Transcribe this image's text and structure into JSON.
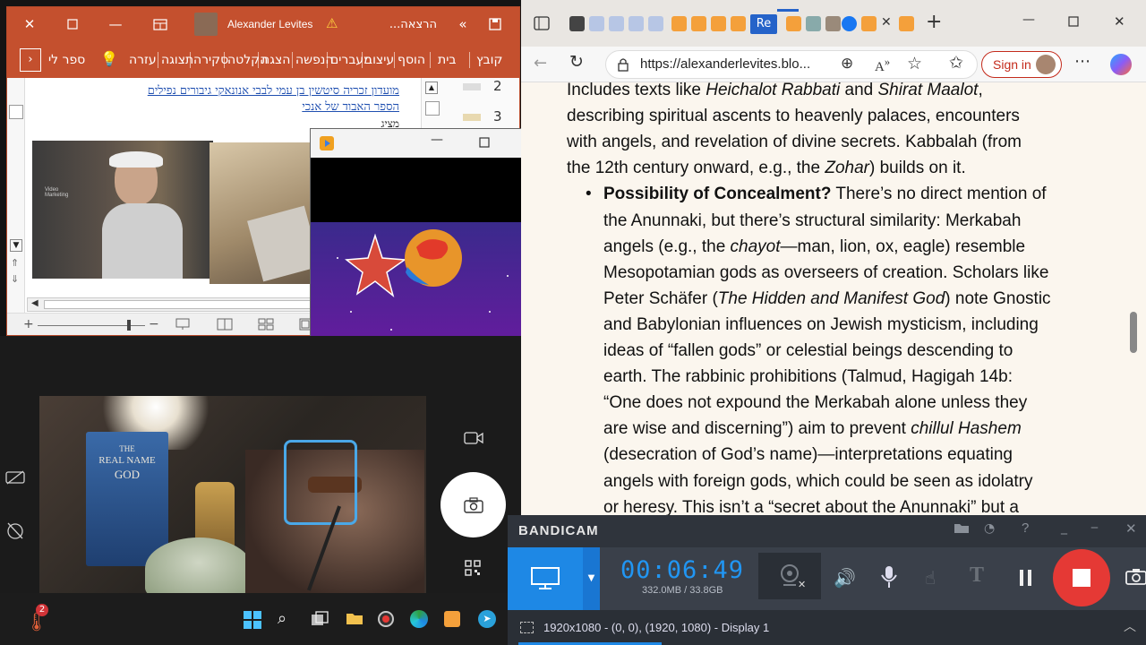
{
  "ppt": {
    "title": "הרצאה...",
    "user": "Alexander Levites",
    "tabs": [
      "קובץ",
      "בית",
      "הוסף",
      "עיצוב",
      "מעברים",
      "הנפשה",
      "הצגת",
      "הקלטה",
      "סקירה",
      "תצוגה",
      "עזרה",
      "ספר לי"
    ],
    "slide_numbers": [
      "2",
      "3"
    ],
    "text_line1": "מועדון זכריה סיטשין בן עמי לבבי אנונאקי גיבורים נפילים",
    "text_line2": "הספר האבוד של אנכי",
    "text_line3": "מציג"
  },
  "browser": {
    "tab_active_label": "Re",
    "url": "https://alexanderlevites.blo...",
    "signin": "Sign in",
    "lines": [
      {
        "parts": [
          [
            "Includes texts like ",
            ""
          ],
          [
            "Heichalot Rabbati",
            "i"
          ],
          [
            " and ",
            ""
          ],
          [
            "Shirat Maalot",
            "i"
          ],
          [
            ",",
            ""
          ]
        ]
      },
      {
        "parts": [
          [
            "describing spiritual ascents to heavenly palaces, encounters",
            ""
          ]
        ]
      },
      {
        "parts": [
          [
            "with angels, and revelation of divine secrets. Kabbalah (from",
            ""
          ]
        ]
      },
      {
        "parts": [
          [
            "the 12th century onward, e.g., the ",
            ""
          ],
          [
            "Zohar",
            "i"
          ],
          [
            ") builds on it.",
            ""
          ]
        ]
      },
      {
        "parts": [
          [
            "Possibility of Concealment?",
            "b"
          ],
          [
            " There’s no direct mention of",
            ""
          ]
        ],
        "bullet": true
      },
      {
        "parts": [
          [
            "the Anunnaki, but there’s structural similarity: Merkabah",
            ""
          ]
        ]
      },
      {
        "parts": [
          [
            "angels (e.g., the ",
            ""
          ],
          [
            "chayot",
            "i"
          ],
          [
            "—man, lion, ox, eagle) resemble",
            ""
          ]
        ]
      },
      {
        "parts": [
          [
            "Mesopotamian gods as overseers of creation. Scholars like",
            ""
          ]
        ]
      },
      {
        "parts": [
          [
            "Peter Schäfer (",
            ""
          ],
          [
            "The Hidden and Manifest God",
            "i"
          ],
          [
            ") note Gnostic",
            ""
          ]
        ]
      },
      {
        "parts": [
          [
            "and Babylonian influences on Jewish mysticism, including",
            ""
          ]
        ]
      },
      {
        "parts": [
          [
            "ideas of “fallen gods” or celestial beings descending to",
            ""
          ]
        ]
      },
      {
        "parts": [
          [
            "earth. The rabbinic prohibitions (Talmud, Hagigah 14b:",
            ""
          ]
        ]
      },
      {
        "parts": [
          [
            "“One does not expound the Merkabah alone unless they",
            ""
          ]
        ]
      },
      {
        "parts": [
          [
            "are wise and discerning”) aim to prevent ",
            ""
          ],
          [
            "chillul Hashem",
            "i"
          ]
        ]
      },
      {
        "parts": [
          [
            "(desecration of God’s name)—interpretations equating",
            ""
          ]
        ]
      },
      {
        "parts": [
          [
            "angels with foreign gods, which could be seen as idolatry",
            ""
          ]
        ]
      },
      {
        "parts": [
          [
            "or heresy. This isn’t a “secret about the Anunnaki” but a",
            ""
          ]
        ]
      }
    ]
  },
  "bandicam": {
    "logo": "BANDICAM",
    "timer": "00:06:49",
    "size": "332.0MB / 33.8GB",
    "display": "1920x1080 - (0, 0), (1920, 1080) - Display 1"
  },
  "camera": {
    "book_line1": "THE",
    "book_line2": "REAL NAME",
    "book_line3": "GOD"
  },
  "taskbar": {
    "badge": "2"
  },
  "colors": {
    "ppt_accent": "#c4502e",
    "bandicam_blue": "#1e88e5",
    "record_red": "#e53935"
  }
}
